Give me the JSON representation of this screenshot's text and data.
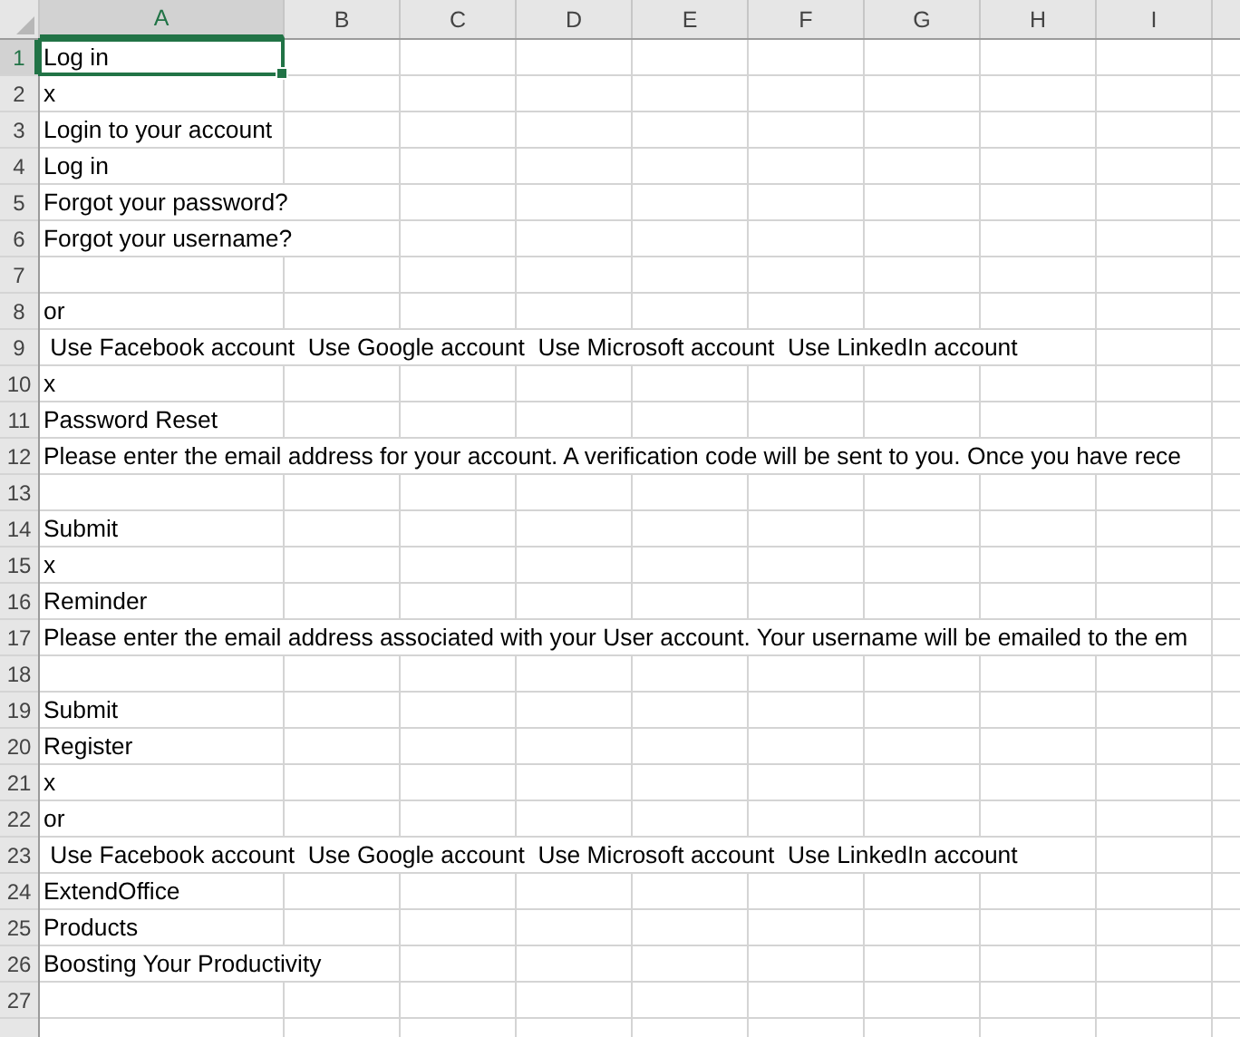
{
  "columns": [
    {
      "label": "A",
      "selected": true
    },
    {
      "label": "B",
      "selected": false
    },
    {
      "label": "C",
      "selected": false
    },
    {
      "label": "D",
      "selected": false
    },
    {
      "label": "E",
      "selected": false
    },
    {
      "label": "F",
      "selected": false
    },
    {
      "label": "G",
      "selected": false
    },
    {
      "label": "H",
      "selected": false
    },
    {
      "label": "I",
      "selected": false
    }
  ],
  "rows": [
    {
      "number": "1",
      "selected": true,
      "a": "Log in"
    },
    {
      "number": "2",
      "selected": false,
      "a": "x"
    },
    {
      "number": "3",
      "selected": false,
      "a": "Login to your account"
    },
    {
      "number": "4",
      "selected": false,
      "a": "Log in"
    },
    {
      "number": "5",
      "selected": false,
      "a": "Forgot your password?"
    },
    {
      "number": "6",
      "selected": false,
      "a": "Forgot your username?"
    },
    {
      "number": "7",
      "selected": false
    },
    {
      "number": "8",
      "selected": false,
      "a": "or"
    },
    {
      "number": "9",
      "selected": false,
      "a": " Use Facebook account  Use Google account  Use Microsoft account  Use LinkedIn account"
    },
    {
      "number": "10",
      "selected": false,
      "a": "x"
    },
    {
      "number": "11",
      "selected": false,
      "a": "Password Reset"
    },
    {
      "number": "12",
      "selected": false,
      "a": "Please enter the email address for your account. A verification code will be sent to you. Once you have rece"
    },
    {
      "number": "13",
      "selected": false
    },
    {
      "number": "14",
      "selected": false,
      "a": "Submit"
    },
    {
      "number": "15",
      "selected": false,
      "a": "x"
    },
    {
      "number": "16",
      "selected": false,
      "a": "Reminder"
    },
    {
      "number": "17",
      "selected": false,
      "a": "Please enter the email address associated with your User account. Your username will be emailed to the em"
    },
    {
      "number": "18",
      "selected": false
    },
    {
      "number": "19",
      "selected": false,
      "a": "Submit"
    },
    {
      "number": "20",
      "selected": false,
      "a": "Register"
    },
    {
      "number": "21",
      "selected": false,
      "a": "x"
    },
    {
      "number": "22",
      "selected": false,
      "a": "or"
    },
    {
      "number": "23",
      "selected": false,
      "a": " Use Facebook account  Use Google account  Use Microsoft account  Use LinkedIn account"
    },
    {
      "number": "24",
      "selected": false,
      "a": "ExtendOffice"
    },
    {
      "number": "25",
      "selected": false,
      "a": "Products"
    },
    {
      "number": "26",
      "selected": false,
      "a": "Boosting Your Productivity"
    },
    {
      "number": "27",
      "selected": false
    }
  ]
}
